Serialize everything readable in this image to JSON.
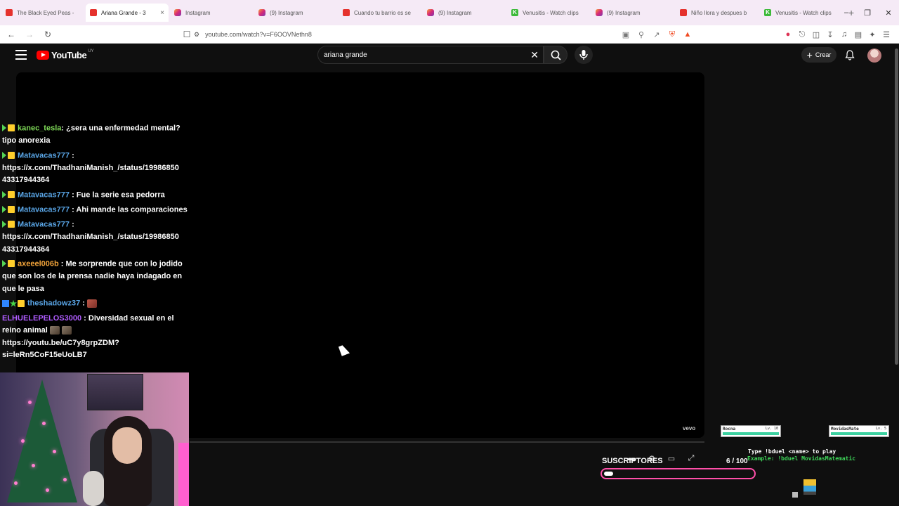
{
  "browser": {
    "tabs": [
      {
        "title": "The Black Eyed Peas -",
        "icon": "youtube",
        "active": false
      },
      {
        "title": "Ariana Grande - 3",
        "icon": "youtube",
        "active": true
      },
      {
        "title": "Instagram",
        "icon": "instagram",
        "active": false
      },
      {
        "title": "(9) Instagram",
        "icon": "instagram",
        "active": false
      },
      {
        "title": "Cuando tu barrio es se",
        "icon": "youtube",
        "active": false
      },
      {
        "title": "(9) Instagram",
        "icon": "instagram",
        "active": false
      },
      {
        "title": "Venusitis - Watch clips",
        "icon": "kick",
        "active": false
      },
      {
        "title": "(9) Instagram",
        "icon": "instagram",
        "active": false
      },
      {
        "title": "Niño llora y despues b",
        "icon": "youtube",
        "active": false
      },
      {
        "title": "Venusitis - Watch clips",
        "icon": "kick",
        "active": false
      }
    ],
    "url": "youtube.com/watch?v=F6OOVNethn8",
    "close_glyph": "×",
    "new_tab_glyph": "+"
  },
  "youtube": {
    "logo_text": "YouTube",
    "country_code": "UY",
    "search_query": "ariana grande",
    "create_label": "Crear"
  },
  "chat": [
    {
      "user": "kanec_tesla",
      "color": "green",
      "badges": [
        "arrow",
        "crown"
      ],
      "text": ": ¿sera una enfermedad mental? tipo anorexia"
    },
    {
      "user": "Matavacas777",
      "color": "blue",
      "badges": [
        "arrow",
        "crown"
      ],
      "text": " : https://x.com/ThadhaniManish_/status/19986850 43317944364"
    },
    {
      "user": "Matavacas777",
      "color": "blue",
      "badges": [
        "arrow",
        "crown"
      ],
      "text": " : Fue la serie esa pedorra"
    },
    {
      "user": "Matavacas777",
      "color": "blue",
      "badges": [
        "arrow",
        "crown"
      ],
      "text": " : Ahi mande las comparaciones"
    },
    {
      "user": "Matavacas777",
      "color": "blue",
      "badges": [
        "arrow",
        "crown"
      ],
      "text": " : https://x.com/ThadhaniManish_/status/19986850 43317944364"
    },
    {
      "user": "axeeel006b",
      "color": "orange",
      "badges": [
        "arrow",
        "crown"
      ],
      "text": " : Me sorprende que con lo jodido que son los de la prensa nadie haya indagado en que le pasa"
    },
    {
      "user": "theshadowz37",
      "color": "blue",
      "badges": [
        "ai",
        "star",
        "crown"
      ],
      "text": " :",
      "emote": "red"
    },
    {
      "user": "ELHUELEPELOS3000",
      "color": "purple",
      "badges": [],
      "text": " : Diversidad sexual en el reino animal",
      "emotes_after": 2,
      "text2": " https://youtu.be/uC7y8grpZDM?si=leRn5CoF15eUoLB7"
    }
  ],
  "overlay": {
    "vevo": "vevo",
    "subs_label": "SUSCRIPTORES",
    "subs_count": "6 / 100",
    "subs_progress": 0.06,
    "duel_card_1": {
      "name": "Rocna",
      "level": "Lv. 10"
    },
    "duel_card_2": {
      "name": "MovidasMate",
      "level": "Lv. 5"
    },
    "duel_line_1": "Type !bduel <name> to play",
    "duel_line_2": "Example: !bduel MovidasMatematic"
  }
}
